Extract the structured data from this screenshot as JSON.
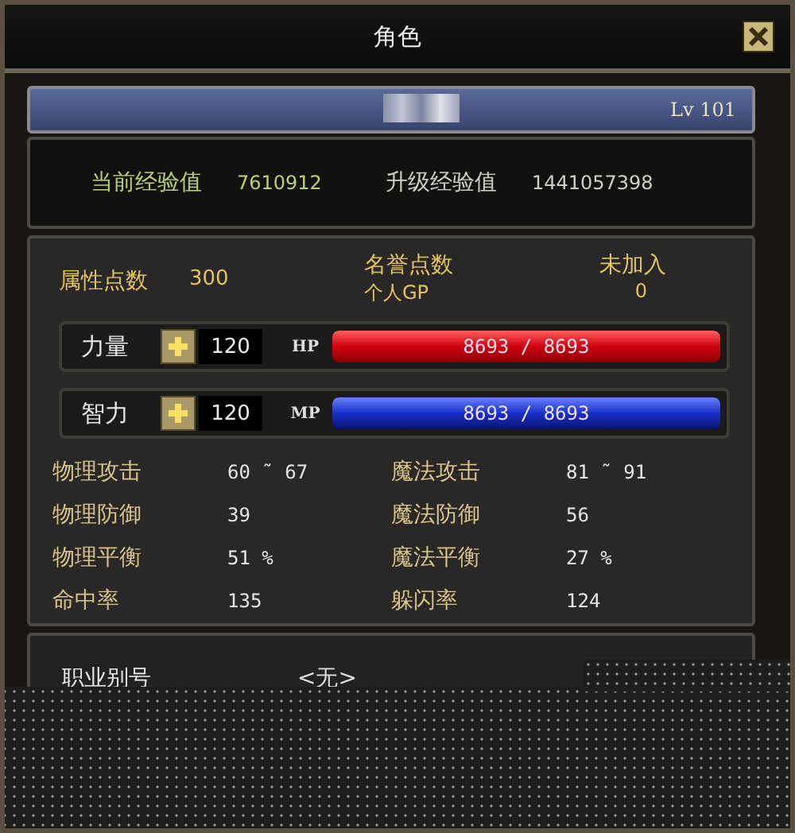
{
  "window": {
    "title": "角色"
  },
  "header": {
    "level": "Lv 101"
  },
  "experience": [
    {
      "label": "当前经验值",
      "value": "7610912",
      "kind": "current"
    },
    {
      "label": "升级经验值",
      "value": "1441057398",
      "kind": "next"
    }
  ],
  "points": {
    "label": "属性点数",
    "value": "300"
  },
  "honor": [
    {
      "label": "名誉点数",
      "value": "未加入"
    },
    {
      "label": "个人GP",
      "value": "0"
    }
  ],
  "resources": [
    {
      "attribute": "力量",
      "attribute_value": "120",
      "bar_label": "HP",
      "reading": "8693 / 8693",
      "level": 1,
      "kind": "hp"
    },
    {
      "attribute": "智力",
      "attribute_value": "120",
      "bar_label": "MP",
      "reading": "8693 / 8693",
      "level": 1,
      "kind": "mp"
    }
  ],
  "stats": [
    {
      "label": "物理攻击",
      "value": "60 ˜ 67"
    },
    {
      "label": "魔法攻击",
      "value": "81 ˜ 91"
    },
    {
      "label": "物理防御",
      "value": "39"
    },
    {
      "label": "魔法防御",
      "value": "56"
    },
    {
      "label": "物理平衡",
      "value": "51 %"
    },
    {
      "label": "魔法平衡",
      "value": "27 %"
    },
    {
      "label": "命中率",
      "value": "135"
    },
    {
      "label": "躲闪率",
      "value": "124"
    }
  ],
  "profile": [
    {
      "label": "职业别号",
      "value": "<无>"
    }
  ]
}
